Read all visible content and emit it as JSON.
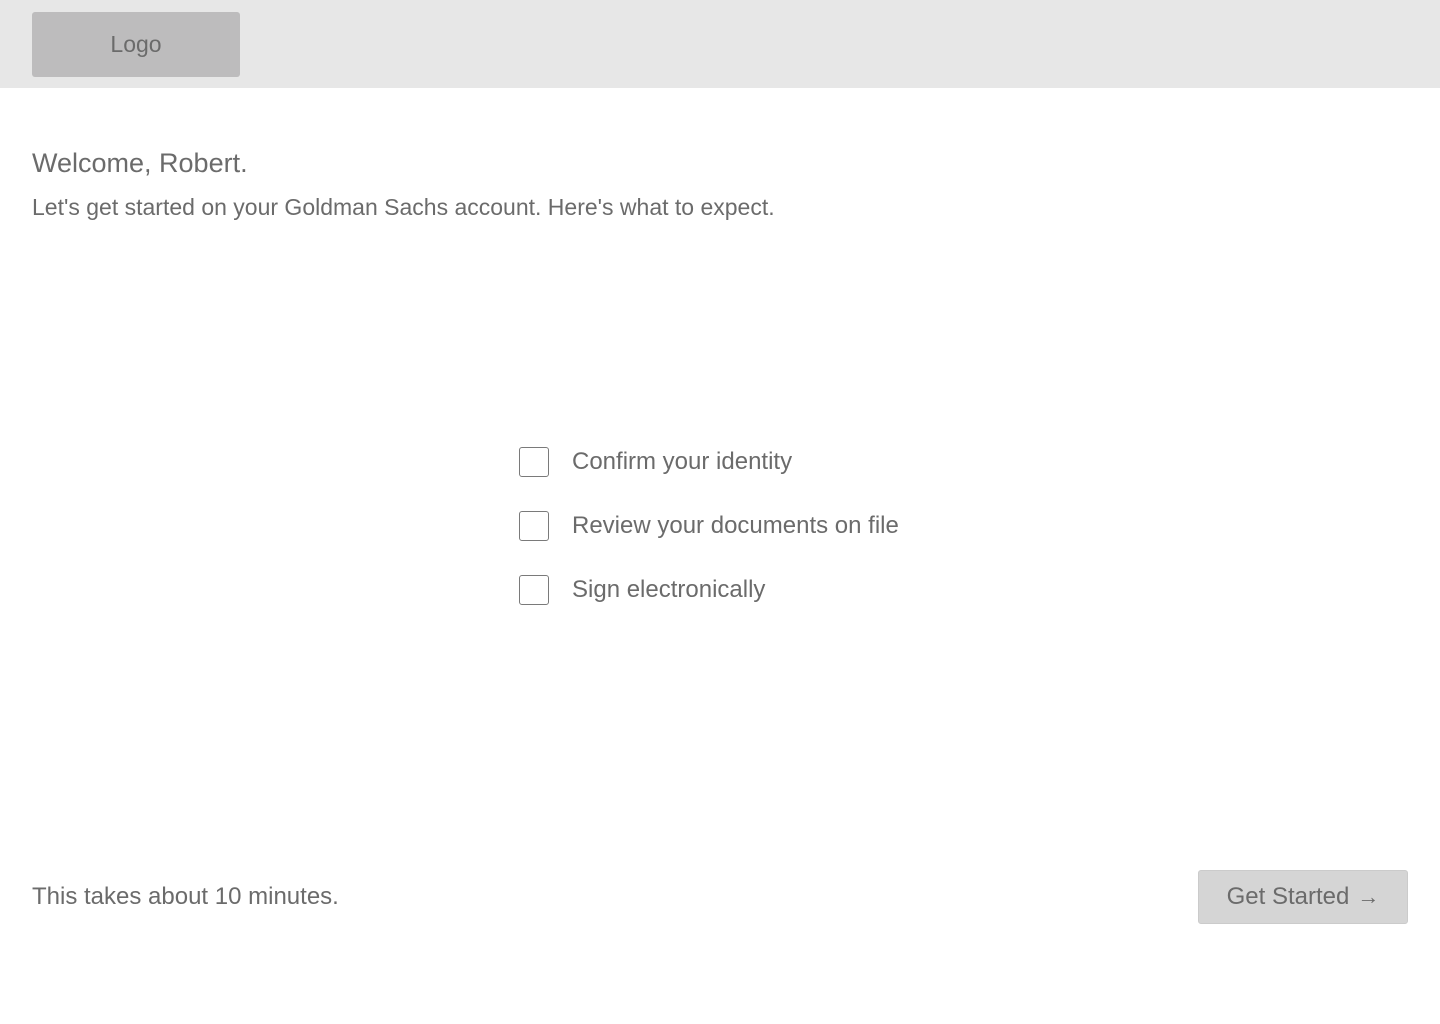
{
  "header": {
    "logo_label": "Logo"
  },
  "welcome": {
    "title": "Welcome, Robert.",
    "subtitle": "Let's get started on your Goldman Sachs account. Here's what to expect."
  },
  "steps": [
    {
      "label": "Confirm your identity",
      "checked": false
    },
    {
      "label": "Review your documents on file",
      "checked": false
    },
    {
      "label": "Sign electronically",
      "checked": false
    }
  ],
  "footer": {
    "note": "This takes about 10 minutes.",
    "button_label": "Get Started",
    "button_icon": "arrow-right-icon",
    "button_icon_glyph": "→"
  },
  "colors": {
    "header_background": "#e7e7e7",
    "logo_background": "#bdbcbd",
    "text": "#6b6b6b",
    "button_background": "#d5d5d5"
  }
}
